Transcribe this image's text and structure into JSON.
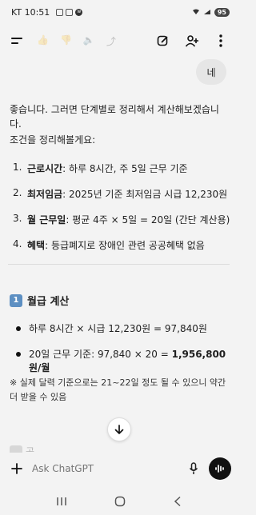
{
  "status_bar": {
    "carrier_time": "KT 10:51",
    "battery": "95"
  },
  "user_message": "네",
  "assistant": {
    "intro": "좋습니다. 그러면 단계별로 정리해서 계산해보겠습니다.",
    "conditions_intro": "조건을 정리해볼게요:",
    "conditions": [
      {
        "num": "1.",
        "label": "근로시간",
        "text": ": 하루 8시간, 주 5일 근무 기준"
      },
      {
        "num": "2.",
        "label": "최저임금",
        "text": ": 2025년 기준 최저임금 시급 12,230원"
      },
      {
        "num": "3.",
        "label": "월 근무일",
        "text": ": 평균 4주 × 5일 = 20일 (간단 계산용)"
      },
      {
        "num": "4.",
        "label": "혜택",
        "text": ": 등급폐지로 장애인 관련 공공혜택 없음"
      }
    ],
    "section1": {
      "number": "1",
      "title": "월급 계산",
      "bullets": [
        {
          "text": "하루 8시간 × 시급 12,230원 = 97,840원",
          "bold": ""
        },
        {
          "text": "20일 근무 기준: 97,840 × 20 = ",
          "bold": "1,956,800원/월"
        }
      ],
      "note": "※ 실제 달력 기준으로는 21~22일 정도 될 수 있으니 약간 더 받을 수 있음"
    },
    "next_section_peek": "공"
  },
  "input": {
    "placeholder": "Ask ChatGPT"
  }
}
